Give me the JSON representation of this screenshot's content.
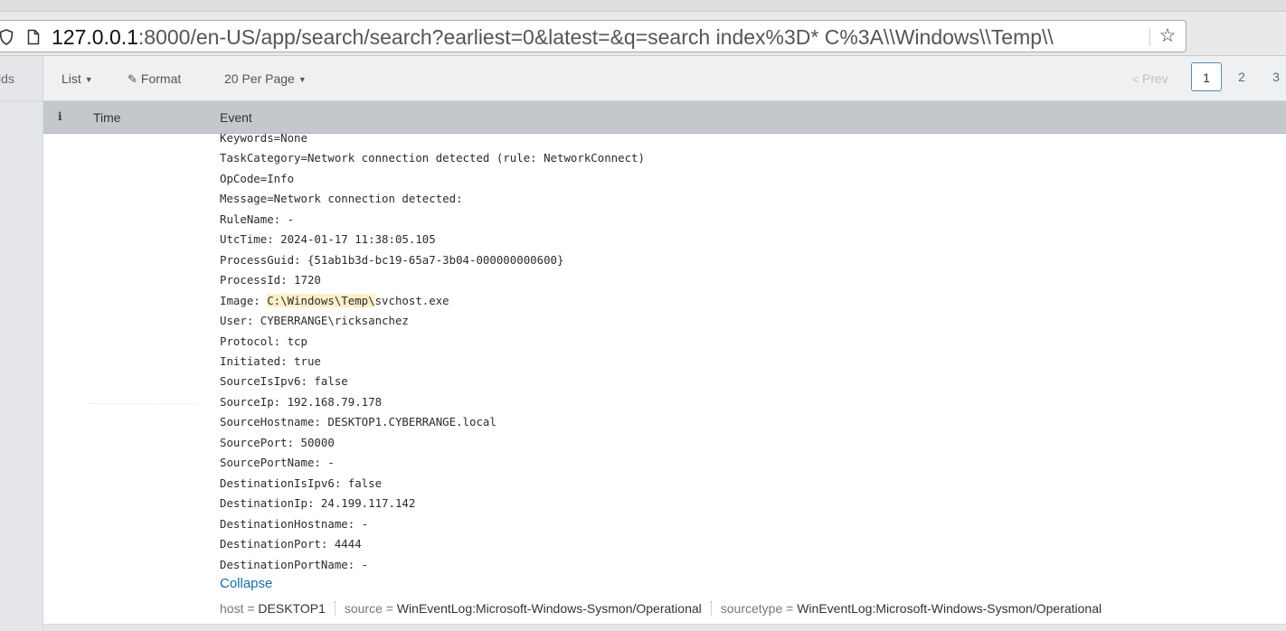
{
  "browser": {
    "url_host": "127.0.0.1",
    "url_rest": ":8000/en-US/app/search/search?earliest=0&latest=&q=search index%3D* C%3A\\\\Windows\\\\Temp\\\\"
  },
  "sidebar": {
    "fields_label_partial": "lds"
  },
  "toolbar": {
    "list_label": "List",
    "format_label": "Format",
    "per_page_label": "20 Per Page",
    "prev_label": "Prev",
    "pages": [
      "1",
      "2",
      "3"
    ],
    "current_page": "1"
  },
  "table": {
    "col_info": "i",
    "col_time": "Time",
    "col_event": "Event"
  },
  "event": {
    "lines": [
      "Keywords=None",
      "TaskCategory=Network connection detected (rule: NetworkConnect)",
      "OpCode=Info",
      "Message=Network connection detected:",
      "RuleName: -",
      "UtcTime: 2024-01-17 11:38:05.105",
      "ProcessGuid: {51ab1b3d-bc19-65a7-3b04-000000000600}",
      "ProcessId: 1720"
    ],
    "image_prefix": "Image: ",
    "image_highlight": "C:\\Windows\\Temp\\",
    "image_suffix": "svchost.exe",
    "lines2": [
      "User: CYBERRANGE\\ricksanchez",
      "Protocol: tcp",
      "Initiated: true",
      "SourceIsIpv6: false",
      "SourceIp: 192.168.79.178",
      "SourceHostname: DESKTOP1.CYBERRANGE.local",
      "SourcePort: 50000",
      "SourcePortName: -",
      "DestinationIsIpv6: false",
      "DestinationIp: 24.199.117.142",
      "DestinationHostname: -",
      "DestinationPort: 4444",
      "DestinationPortName: -"
    ],
    "collapse_label": "Collapse",
    "fields": {
      "host_key": "host =",
      "host_val": "DESKTOP1",
      "source_key": "source =",
      "source_val": "WinEventLog:Microsoft-Windows-Sysmon/Operational",
      "sourcetype_key": "sourcetype =",
      "sourcetype_val": "WinEventLog:Microsoft-Windows-Sysmon/Operational"
    }
  },
  "colors": {
    "link": "#1a6fa3",
    "highlight": "#fdf0c8",
    "header_bg": "#c4c8cc"
  }
}
